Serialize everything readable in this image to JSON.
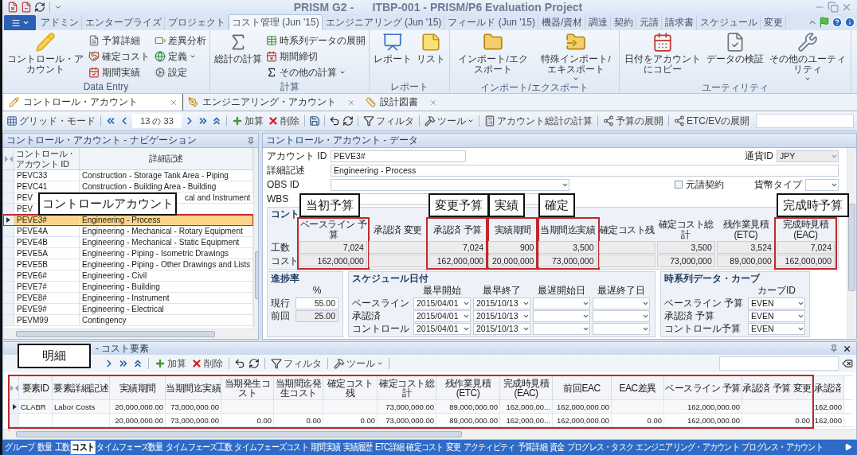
{
  "window": {
    "title": "PRISM G2 -      ITBP-001 - PRISM/P6 Evaluation Project"
  },
  "ribbon_tabs": [
    {
      "label": "アドミン",
      "selected": false
    },
    {
      "label": "エンタープライズ",
      "selected": false
    },
    {
      "label": "プロジェクト",
      "selected": false
    },
    {
      "label": "コスト管理 (Jun '15)",
      "selected": true
    },
    {
      "label": "エンジニアリング (Jun '15)",
      "selected": false
    },
    {
      "label": "フィールド (Jun '15)",
      "selected": false
    },
    {
      "label": "機器/資材",
      "selected": false
    },
    {
      "label": "調達",
      "selected": false
    },
    {
      "label": "契約",
      "selected": false
    },
    {
      "label": "元請",
      "selected": false
    },
    {
      "label": "請求書",
      "selected": false
    },
    {
      "label": "スケジュール",
      "selected": false
    },
    {
      "label": "変更",
      "selected": false
    }
  ],
  "ribbon_groups": [
    {
      "title": "Data Entry",
      "large": [
        {
          "label": "コントロール・アカウント",
          "dropdown": false
        }
      ],
      "small": [
        {
          "label": "予算詳細",
          "dropdown": false
        },
        {
          "label": "確定コスト",
          "dropdown": false
        },
        {
          "label": "期間実績",
          "dropdown": false
        },
        {
          "label": "差異分析",
          "dropdown": false
        },
        {
          "label": "定義",
          "dropdown": true
        },
        {
          "label": "設定",
          "dropdown": false
        }
      ]
    },
    {
      "title": "計算",
      "large": [
        {
          "label": "総計の計算",
          "dropdown": false
        }
      ],
      "small": [
        {
          "label": "時系列データの展開",
          "dropdown": false
        },
        {
          "label": "期間締切",
          "dropdown": false
        },
        {
          "label": "その他の計算",
          "dropdown": true
        }
      ]
    },
    {
      "title": "レポート",
      "large": [
        {
          "label": "レポート",
          "dropdown": false
        },
        {
          "label": "リスト",
          "dropdown": false
        }
      ]
    },
    {
      "title": "インポート/エクスポート",
      "large": [
        {
          "label": "インポート/エクスポート",
          "dropdown": false
        },
        {
          "label": "特殊インポート/エキスポート",
          "dropdown": true
        }
      ]
    },
    {
      "title": "ユーティリティ",
      "large": [
        {
          "label": "日付をアカウントにコピー",
          "dropdown": false
        },
        {
          "label": "データの検証",
          "dropdown": false
        },
        {
          "label": "その他のユーティリティ",
          "dropdown": true
        }
      ]
    }
  ],
  "doc_tabs": [
    {
      "label": "コントロール・アカウント",
      "selected": true
    },
    {
      "label": "エンジニアリング・アカウント",
      "selected": false
    },
    {
      "label": "設計図書",
      "selected": false
    }
  ],
  "toolbar": {
    "grid_mode": "グリッド・モード",
    "record": "13 の 33",
    "add": "加算",
    "delete": "削除",
    "filter": "フィルタ",
    "tools": "ツール",
    "account_total": "アカウント総計の計算",
    "budget_spread": "予算の展開",
    "etc_spread": "ETC/EVの展開"
  },
  "navigation": {
    "title": "コントロール・アカウント - ナビゲーション",
    "callout": "コントロールアカウント",
    "columns": [
      "コントロール・アカウント ID",
      "詳細記述"
    ],
    "rows": [
      {
        "id": "PEVC33",
        "description": "Construction - Storage Tank Area - Piping",
        "kind": "full",
        "selected": false
      },
      {
        "id": "PEVC41",
        "description": "Construction - Building Area - Building",
        "kind": "full",
        "selected": false
      },
      {
        "id": "PEV",
        "description": "cal and Instrument",
        "kind": "covered",
        "selected": false
      },
      {
        "id": "PEV",
        "selected": false
      },
      {
        "id": "PEVE3#",
        "description": "Engineering - Process",
        "kind": "full",
        "selected": true
      },
      {
        "id": "PEVE4A",
        "description": "Engineering - Mechanical - Rotary Equipment",
        "kind": "full",
        "selected": false
      },
      {
        "id": "PEVE4B",
        "description": "Engineering - Mechanical - Static Equipment",
        "kind": "full",
        "selected": false
      },
      {
        "id": "PEVE5A",
        "description": "Engineering - Piping - Isometric Drawings",
        "kind": "full",
        "selected": false
      },
      {
        "id": "PEVE5B",
        "description": "Engineering - Piping - Other Drawings and Lists",
        "kind": "full",
        "selected": false
      },
      {
        "id": "PEVE6#",
        "description": "Engineering - Civil",
        "kind": "full",
        "selected": false
      },
      {
        "id": "PEVE7#",
        "description": "Engineering - Building",
        "kind": "full",
        "selected": false
      },
      {
        "id": "PEVE8#",
        "description": "Engineering - Instrument",
        "kind": "full",
        "selected": false
      },
      {
        "id": "PEVE9#",
        "description": "Engineering - Electrical",
        "kind": "full",
        "selected": false
      },
      {
        "id": "PEVM99",
        "description": "Contingency",
        "kind": "full",
        "selected": false
      }
    ]
  },
  "account": {
    "title": "コントロール・アカウント - データ",
    "id_label": "アカウント ID",
    "id_value": "PEVE3#",
    "currency_label": "通貨ID",
    "currency_value": "JPY",
    "description_label": "詳細記述",
    "description_value": "Engineering - Process",
    "obs_label": "OBS ID",
    "prime_contract": {
      "label": "元請契約",
      "checked": false
    },
    "currency_type_label": "貨幣タイプ",
    "wbs_label": "WBS"
  },
  "summary": {
    "title": "コント",
    "row_labels": [
      "工数",
      "コスト"
    ],
    "columns": [
      {
        "header": "ベースライン 予算",
        "work": "7,024",
        "cost": "162,000,000",
        "highlighted": true,
        "callout": "当初予算"
      },
      {
        "header": "承認済 変更",
        "highlighted": false
      },
      {
        "header": "承認済 予算",
        "work": "7,024",
        "cost": "162,000,000",
        "highlighted": true,
        "callout": "変更予算"
      },
      {
        "header": "実績期間",
        "work": "900",
        "cost": "20,000,000",
        "highlighted": true,
        "callout": "実績"
      },
      {
        "header": "当期間迄実績",
        "work": "3,500",
        "cost": "73,000,000",
        "highlighted": true,
        "callout": "確定"
      },
      {
        "header": "確定コスト残",
        "highlighted": false
      },
      {
        "header": "確定コスト総計",
        "work": "3,500",
        "cost": "73,000,000",
        "highlighted": false
      },
      {
        "header": "残作業見積(ETC)",
        "work": "3,524",
        "cost": "89,000,000",
        "highlighted": false
      },
      {
        "header": "完成時見積(EAC)",
        "work": "7,024",
        "cost": "162,000,000",
        "highlighted": true,
        "callout": "完成時予算"
      }
    ]
  },
  "progress": {
    "title": "進捗率",
    "unit": "%",
    "rows": [
      {
        "label": "現行",
        "value": "55.00",
        "disabled": false
      },
      {
        "label": "前回",
        "value": "25.00",
        "disabled": true
      }
    ]
  },
  "schedule": {
    "title": "スケジュール日付",
    "columns": [
      "最早開始",
      "最早終了",
      "最遅開始日",
      "最遅終了日"
    ],
    "rows": [
      {
        "label": "ベースライン",
        "early_start": "2015/04/01",
        "early_finish": "2015/10/13"
      },
      {
        "label": "承認済",
        "early_start": "2015/04/01",
        "early_finish": "2015/10/13"
      },
      {
        "label": "コントロール",
        "early_start": "2015/04/01",
        "early_finish": "2015/10/13"
      }
    ]
  },
  "curves": {
    "title": "時系列データ・カーブ",
    "column": "カーブID",
    "rows": [
      {
        "label": "ベースライン 予算",
        "value": "EVEN"
      },
      {
        "label": "承認済 予算",
        "value": "EVEN"
      },
      {
        "label": "コントロール予算",
        "value": "EVEN"
      }
    ]
  },
  "elements": {
    "title": "- コスト要素",
    "callout": "明細",
    "highlighted": true,
    "toolbar": {
      "add": "加算",
      "delete": "削除",
      "filter": "フィルタ",
      "tools": "ツール"
    },
    "columns": [
      "要素ID",
      "要素詳細記述",
      "実績期間",
      "当期間迄実績",
      "当期発生コスト",
      "当期間迄発生コスト",
      "確定コスト残",
      "確定コスト総計",
      "残作業見積(ETC)",
      "完成時見積(EAC)",
      "前回EAC",
      "EAC差異",
      "ベースライン 予算",
      "承認済 予算 変更",
      "承認済"
    ],
    "rows": [
      {
        "kind": "record",
        "cells": [
          "CLABR",
          "Labor Costs",
          "20,000,000.00",
          "73,000,000.00",
          null,
          null,
          null,
          "73,000,000.00",
          "89,000,000.00",
          "162,000,00...",
          "162,000,000.00",
          null,
          "162,000,000.00",
          null,
          "162,000"
        ]
      },
      {
        "kind": "total",
        "cells": [
          null,
          null,
          "20,000,000.00",
          "73,000,000.00",
          "0.00",
          "0.00",
          "0.00",
          "73,000,000.00",
          "89,000,000.00",
          "162,000,00...",
          "162,000,000.00",
          "0.00",
          "162,000,000.00",
          "0.00",
          "162,000"
        ]
      }
    ]
  },
  "bottom_tabs": [
    {
      "label": "グループ",
      "selected": false
    },
    {
      "label": "数量",
      "selected": false
    },
    {
      "label": "工数",
      "selected": false
    },
    {
      "label": "コスト",
      "selected": true
    },
    {
      "label": "タイムフェーズ数量",
      "selected": false
    },
    {
      "label": "タイムフェーズ工数",
      "selected": false
    },
    {
      "label": "タイムフェーズコスト",
      "selected": false
    },
    {
      "label": "期間実績",
      "selected": false
    },
    {
      "label": "実績履歴",
      "selected": false
    },
    {
      "label": "ETC詳細",
      "selected": false
    },
    {
      "label": "確定コスト",
      "selected": false
    },
    {
      "label": "変更",
      "selected": false
    },
    {
      "label": "アクティビティ",
      "selected": false
    },
    {
      "label": "予算詳細",
      "selected": false
    },
    {
      "label": "資金",
      "selected": false
    },
    {
      "label": "プログレス・タスク",
      "selected": false
    },
    {
      "label": "エンジニアリング・アカウント",
      "selected": false
    },
    {
      "label": "プログレス・アカウント",
      "selected": false
    }
  ]
}
